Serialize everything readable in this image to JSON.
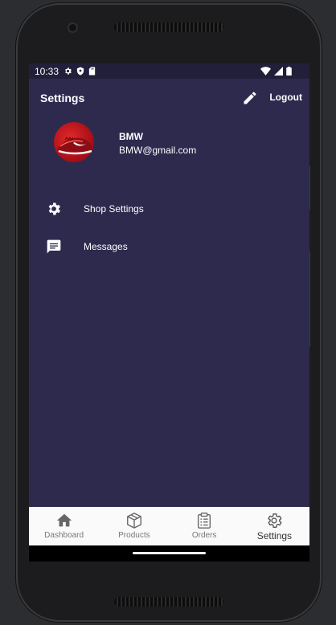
{
  "status_bar": {
    "time": "10:33"
  },
  "app_bar": {
    "title": "Settings",
    "logout_label": "Logout",
    "edit_icon": "pencil-icon"
  },
  "profile": {
    "name": "BMW",
    "email": "BMW@gmail.com"
  },
  "menu": [
    {
      "label": "Shop Settings",
      "icon": "gear-icon"
    },
    {
      "label": "Messages",
      "icon": "message-icon"
    }
  ],
  "bottom_nav": [
    {
      "label": "Dashboard",
      "icon": "home-icon",
      "active": false
    },
    {
      "label": "Products",
      "icon": "box-icon",
      "active": false
    },
    {
      "label": "Orders",
      "icon": "clipboard-icon",
      "active": false
    },
    {
      "label": "Settings",
      "icon": "gear-icon",
      "active": true
    }
  ],
  "colors": {
    "background": "#2d2a4e",
    "status_bar": "#211f3a",
    "nav_background": "#fafafa",
    "text": "#ffffff"
  }
}
